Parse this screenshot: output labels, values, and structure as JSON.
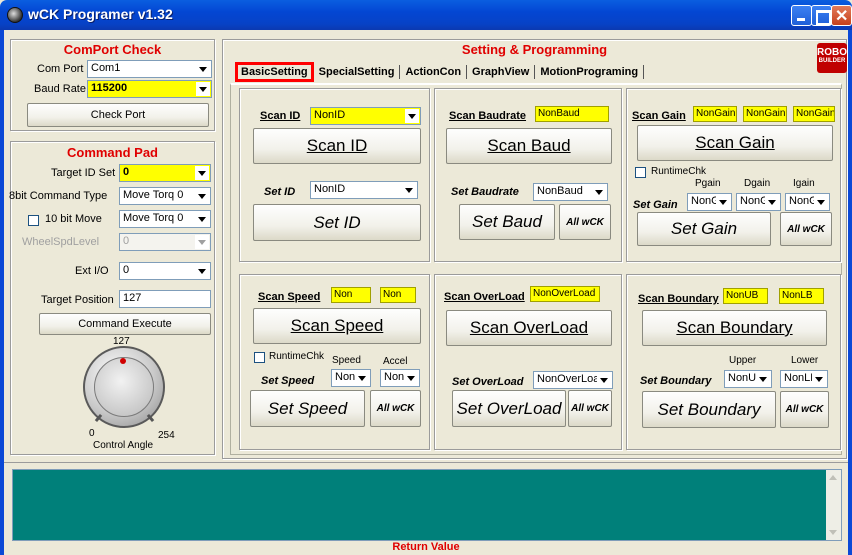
{
  "window": {
    "title": "wCK Programer v1.32"
  },
  "comport": {
    "title": "ComPort Check",
    "port_label": "Com Port",
    "port_value": "Com1",
    "baud_label": "Baud Rate",
    "baud_value": "115200",
    "check_button": "Check Port"
  },
  "command_pad": {
    "title": "Command Pad",
    "target_id_label": "Target ID Set",
    "target_id_value": "0",
    "cmd8_label": "8bit Command Type",
    "cmd8_value": "Move Torq 0",
    "cmd10_label": "10 bit Move",
    "cmd10_value": "Move Torq 0",
    "wheel_label": "WheelSpdLevel",
    "wheel_value": "0",
    "extio_label": "Ext I/O",
    "extio_value": "0",
    "target_pos_label": "Target Position",
    "target_pos_value": "127",
    "execute_button": "Command Execute",
    "knob_top": "127",
    "knob_min": "0",
    "knob_max": "254",
    "knob_label": "Control Angle"
  },
  "setting": {
    "title": "Setting & Programming",
    "logo_line1": "ROBO",
    "logo_line2": "BUILDER",
    "tabs": [
      "BasicSetting",
      "SpecialSetting",
      "ActionCon",
      "GraphView",
      "MotionPrograming"
    ],
    "scan_id": {
      "title": "Scan ID",
      "value": "NonID",
      "button": "Scan ID",
      "set_label": "Set ID",
      "set_value": "NonID",
      "set_button": "Set ID"
    },
    "scan_baud": {
      "title": "Scan Baudrate",
      "value": "NonBaud",
      "button": "Scan Baud",
      "set_label": "Set Baudrate",
      "set_value": "NonBaud",
      "set_button": "Set Baud",
      "all_button": "All wCK"
    },
    "scan_gain": {
      "title": "Scan Gain",
      "v1": "NonGain",
      "v2": "NonGain",
      "v3": "NonGain",
      "button": "Scan Gain",
      "runtime": "RuntimeChk",
      "pgain": "Pgain",
      "dgain": "Dgain",
      "igain": "Igain",
      "set_label": "Set Gain",
      "s1": "NonG",
      "s2": "NonG",
      "s3": "NonG",
      "set_button": "Set Gain",
      "all_button": "All wCK"
    },
    "scan_speed": {
      "title": "Scan Speed",
      "v1": "Non",
      "v2": "Non",
      "button": "Scan Speed",
      "runtime": "RuntimeChk",
      "speed": "Speed",
      "accel": "Accel",
      "set_label": "Set Speed",
      "s1": "Non",
      "s2": "Non",
      "set_button": "Set Speed",
      "all_button": "All wCK"
    },
    "scan_overload": {
      "title": "Scan OverLoad",
      "value": "NonOverLoad",
      "button": "Scan OverLoad",
      "set_label": "Set OverLoad",
      "set_value": "NonOverLoad",
      "set_button": "Set OverLoad",
      "all_button": "All wCK"
    },
    "scan_boundary": {
      "title": "Scan Boundary",
      "v1": "NonUB",
      "v2": "NonLB",
      "button": "Scan Boundary",
      "upper": "Upper",
      "lower": "Lower",
      "set_label": "Set Boundary",
      "s1": "NonU",
      "s2": "NonLB",
      "set_button": "Set Boundary",
      "all_button": "All wCK"
    }
  },
  "return_value": {
    "label": "Return Value"
  }
}
